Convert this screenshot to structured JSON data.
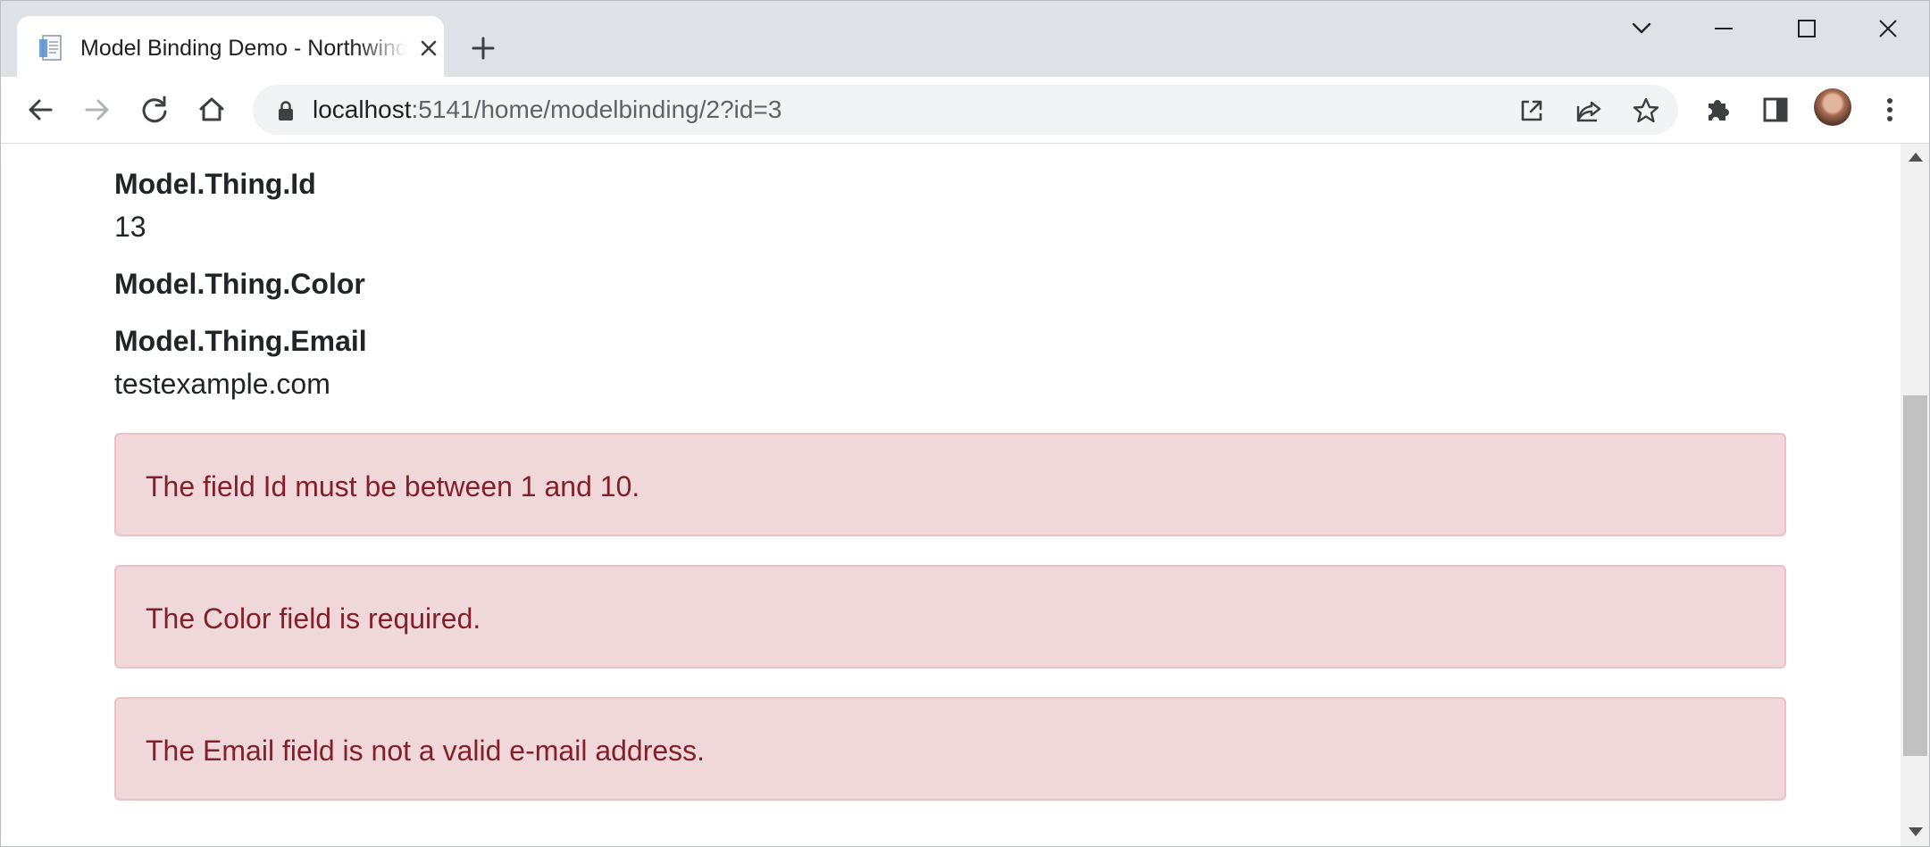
{
  "browser": {
    "tab": {
      "title": "Model Binding Demo - Northwind",
      "favicon": "document-icon",
      "close_icon": "close-icon"
    },
    "new_tab_icon": "plus-icon",
    "window_controls": [
      "chevron-down-icon",
      "minimize-icon",
      "maximize-icon",
      "close-icon"
    ],
    "nav": [
      "back-arrow-icon",
      "forward-arrow-icon",
      "reload-icon",
      "home-icon"
    ],
    "address_bar": {
      "host": "localhost",
      "path": ":5141/home/modelbinding/2?id=3"
    },
    "toolbar_icons": [
      "open-in-app-icon",
      "share-icon",
      "bookmark-star-icon",
      "extensions-puzzle-icon",
      "side-panel-icon",
      "avatar",
      "more-vert-icon"
    ]
  },
  "page": {
    "fields": [
      {
        "label": "Model.Thing.Id",
        "value": "13"
      },
      {
        "label": "Model.Thing.Color",
        "value": ""
      },
      {
        "label": "Model.Thing.Email",
        "value": "testexample.com"
      }
    ],
    "errors": [
      "The field Id must be between 1 and 10.",
      "The Color field is required.",
      "The Email field is not a valid e-mail address."
    ]
  },
  "colors": {
    "alert_bg": "#f0d7da",
    "alert_border": "#ebc1c6",
    "alert_text": "#842029",
    "tabstrip_bg": "#dee1e6",
    "omnibox_bg": "#f1f3f4"
  }
}
